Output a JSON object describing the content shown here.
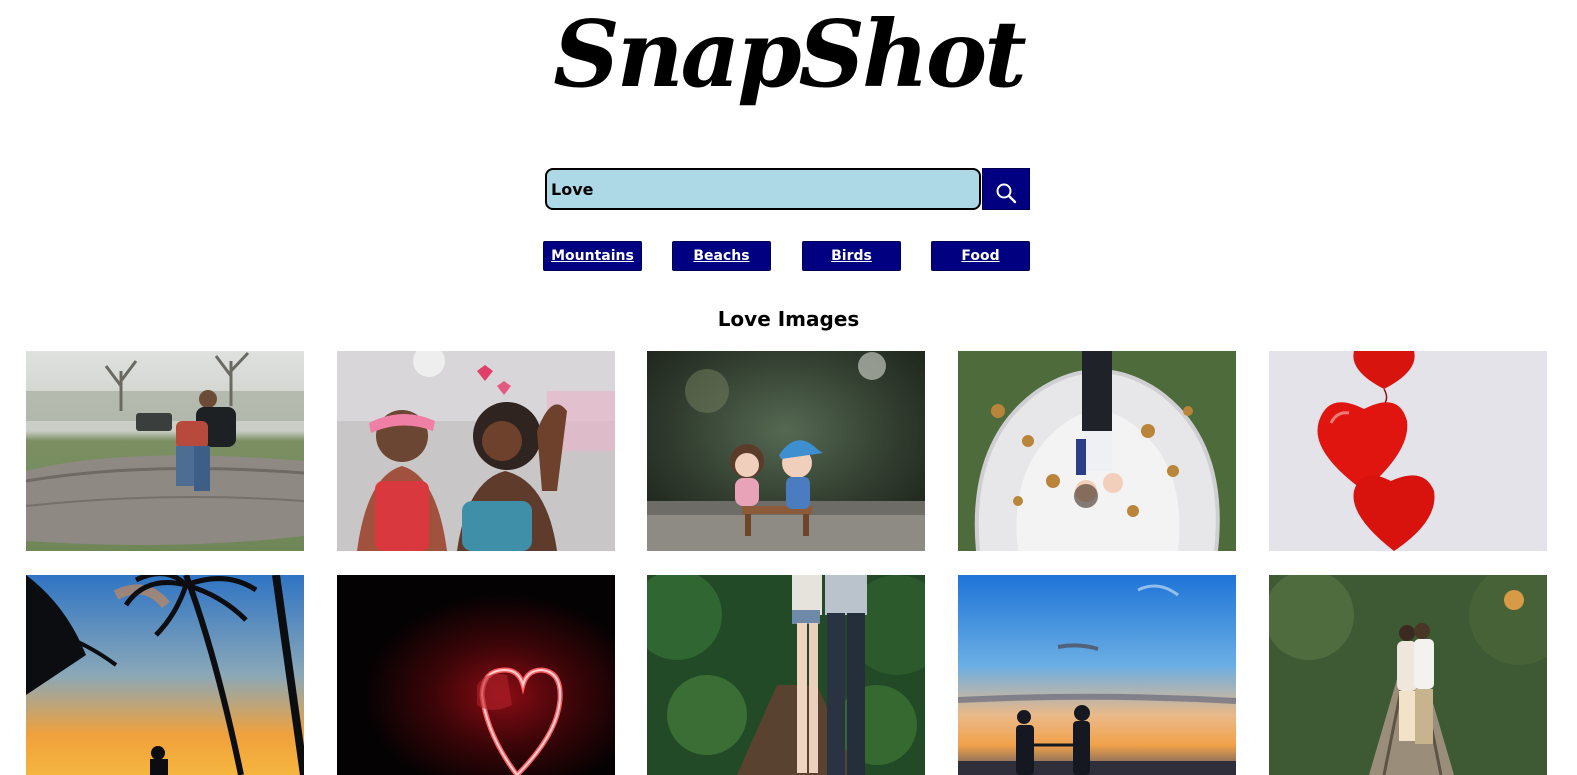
{
  "header": {
    "logo_text": "SnapShot"
  },
  "search": {
    "value": "Love",
    "icon": "magnifier-icon"
  },
  "categories": [
    {
      "label": "Mountains"
    },
    {
      "label": "Beachs"
    },
    {
      "label": "Birds"
    },
    {
      "label": "Food"
    }
  ],
  "gallery": {
    "heading": "Love Images",
    "photos": [
      {
        "subject": "couple sitting on fallen log in field"
      },
      {
        "subject": "two women laughing near heart decorations"
      },
      {
        "subject": "toy boy and girl figurines on bench"
      },
      {
        "subject": "bride and groom lying on veil, overhead view"
      },
      {
        "subject": "red heart-shaped balloons"
      },
      {
        "subject": "couple silhouette under palm trees at sunset"
      },
      {
        "subject": "red neon heart in the dark"
      },
      {
        "subject": "couple standing on forest path"
      },
      {
        "subject": "couple holding hands at sunset"
      },
      {
        "subject": "couple embracing on railway track"
      }
    ]
  },
  "colors": {
    "search_field_bg": "#add8e6",
    "button_bg": "#000080",
    "button_text": "#ffffff",
    "page_bg": "#ffffff"
  }
}
